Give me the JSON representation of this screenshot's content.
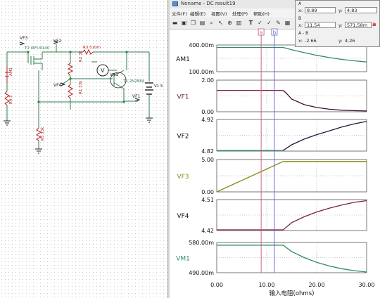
{
  "schematic": {
    "labels": {
      "vf3": "VF3",
      "vf2": "VF2",
      "vf4": "VF4",
      "vf1": "VF1",
      "t2": "T2 IRFU9140",
      "r3": "R3 510m",
      "r2": "R2 3k",
      "r1": "R1 33k",
      "vm1": "VM1",
      "t1": "T1 2N2884",
      "v1": "V1 5",
      "am1": "AM1",
      "r4": "R4 5",
      "r5": "R5 33k"
    }
  },
  "window": {
    "title": "Noname - DC result19",
    "menu": [
      "文件(F)",
      "编辑(E)",
      "视图(V)",
      "处理(P)",
      "帮助(H)"
    ]
  },
  "cursor_panel": {
    "a_header": "A",
    "a_x": "8.89",
    "a_y": "4.83",
    "b_header": "B",
    "b_x": "11.54",
    "b_y": "571.58m",
    "diff_header": "A - B",
    "diff_x": "-2.66",
    "diff_y": "4.26",
    "x_label": "x:",
    "y_label": "y:"
  },
  "cursors": {
    "a_label": "a",
    "b_label": "b",
    "a_x": 8.89,
    "b_x": 11.54,
    "a_color": "#c8557a",
    "b_color": "#6a5acd"
  },
  "x_axis": {
    "label": "输入电阻(ohms)",
    "ticks": [
      "0.00",
      "10.00",
      "20.00",
      "30.00"
    ]
  },
  "chart_data": [
    {
      "type": "line",
      "name": "AM1",
      "name_color": "#111111",
      "color": "#2f8a6a",
      "ylim": [
        100,
        400
      ],
      "ytick_labels": [
        "400.00m",
        "100.00m"
      ],
      "x": [
        0,
        13.3,
        15,
        17.5,
        20,
        22.5,
        25,
        27.5,
        30
      ],
      "y": [
        372,
        372,
        346,
        314,
        284,
        259,
        238,
        222,
        210
      ]
    },
    {
      "type": "line",
      "name": "VF1",
      "name_color": "#7a2040",
      "color": "#3a1030",
      "flat_color": "#7a2040",
      "ylim": [
        0,
        2
      ],
      "ytick_labels": [
        "2.00",
        "0.00"
      ],
      "x": [
        0,
        13.3,
        14,
        15,
        17.5,
        20,
        22.5,
        25,
        27.5,
        30
      ],
      "y": [
        1.35,
        1.35,
        1.15,
        0.8,
        0.45,
        0.27,
        0.16,
        0.1,
        0.07,
        0.05
      ]
    },
    {
      "type": "line",
      "name": "VF2",
      "name_color": "#111111",
      "color": "#1c1c3a",
      "flat_color": "#2f8a6a",
      "ylim": [
        4.82,
        4.92
      ],
      "ytick_labels": [
        "4.92",
        "4.82"
      ],
      "x": [
        0,
        13.3,
        15,
        17.5,
        20,
        22.5,
        25,
        27.5,
        30
      ],
      "y": [
        4.822,
        4.822,
        4.84,
        4.858,
        4.872,
        4.884,
        4.896,
        4.906,
        4.914
      ]
    },
    {
      "type": "line",
      "name": "VF3",
      "name_color": "#8a8a10",
      "color": "#8a8a10",
      "ylim": [
        0,
        5
      ],
      "ytick_labels": [
        "5.00",
        "0.00"
      ],
      "x": [
        0,
        13.3,
        30
      ],
      "y": [
        0,
        4.7,
        4.7
      ]
    },
    {
      "type": "line",
      "name": "VF4",
      "name_color": "#111111",
      "color": "#7a2040",
      "ylim": [
        4.42,
        4.51
      ],
      "ytick_labels": [
        "4.51",
        "4.42"
      ],
      "x": [
        0,
        13.3,
        15,
        17.5,
        20,
        22.5,
        25,
        27.5,
        30
      ],
      "y": [
        4.422,
        4.422,
        4.443,
        4.46,
        4.474,
        4.485,
        4.494,
        4.502,
        4.507
      ]
    },
    {
      "type": "line",
      "name": "VM1",
      "name_color": "#2f8a6a",
      "color": "#2f8a6a",
      "ylim": [
        490,
        580
      ],
      "ytick_labels": [
        "580.00m",
        "490.00m"
      ],
      "x": [
        0,
        13.3,
        15,
        17.5,
        20,
        22.5,
        25,
        27.5,
        30
      ],
      "y": [
        572,
        572,
        553,
        535,
        521,
        510,
        502,
        496,
        492
      ]
    }
  ]
}
